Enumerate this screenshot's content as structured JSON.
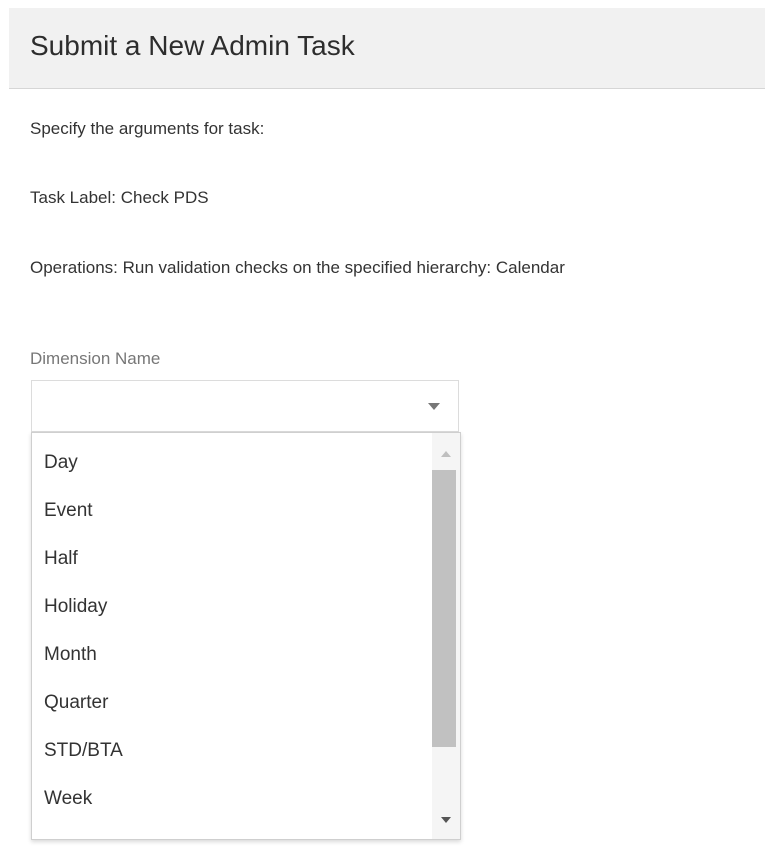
{
  "dialog": {
    "title": "Submit a New Admin Task"
  },
  "content": {
    "intro": "Specify the arguments for task:",
    "task_label": "Task Label: Check PDS",
    "operations": "Operations: Run validation checks on the specified hierarchy: Calendar"
  },
  "dimension": {
    "label": "Dimension Name",
    "selected": "",
    "caret_icon": "chevron-down-icon",
    "options": [
      "Day",
      "Event",
      "Half",
      "Holiday",
      "Month",
      "Quarter",
      "STD/BTA",
      "Week"
    ]
  },
  "colors": {
    "header_bg": "#f1f1f1",
    "scroll_thumb": "#c1c1c1"
  }
}
